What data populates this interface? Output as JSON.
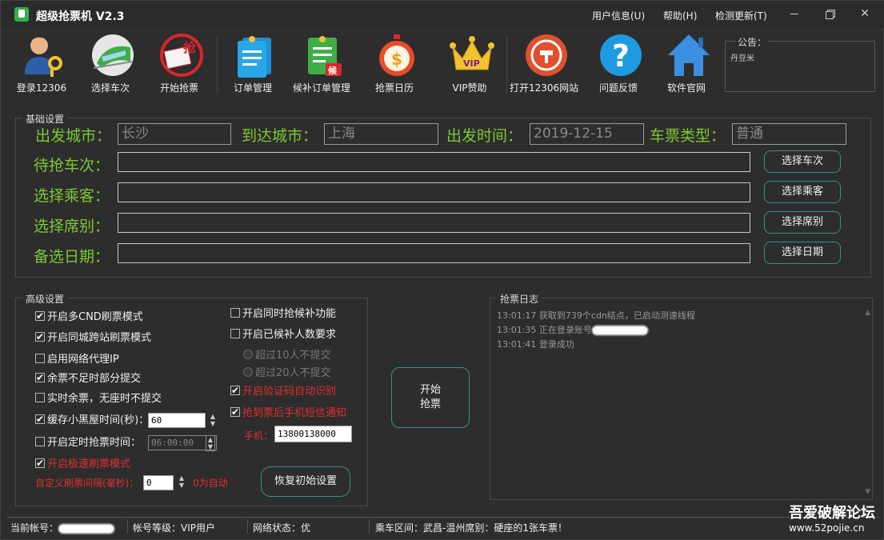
{
  "titlebar": {
    "title": "超级抢票机 V2.3",
    "menu_user": "用户信息(U)",
    "menu_help": "帮助(H)",
    "menu_update": "检测更新(T)"
  },
  "toolbar": {
    "login": "登录12306",
    "select_train": "选择车次",
    "start_grab": "开始抢票",
    "order_mgmt": "订单管理",
    "waitlist_mgmt": "候补订单管理",
    "grab_calendar": "抢票日历",
    "vip": "VIP赞助",
    "open_site": "打开12306网站",
    "feedback": "问题反馈",
    "official_site": "软件官网",
    "vip_badge": "VIP",
    "waitlist_badge": "候",
    "grab_badge": "抢"
  },
  "notice": {
    "title": "公告：",
    "body": "丹豆米"
  },
  "basic": {
    "title": "基础设置",
    "from_label": "出发城市：",
    "from_value": "长沙",
    "to_label": "到达城市：",
    "to_value": "上海",
    "date_label": "出发时间：",
    "date_value": "2019-12-15",
    "type_label": "车票类型：",
    "type_value": "普通",
    "train_label": "待抢车次：",
    "passenger_label": "选择乘客：",
    "seat_label": "选择席别：",
    "altdate_label": "备选日期：",
    "btn_train": "选择车次",
    "btn_passenger": "选择乘客",
    "btn_seat": "选择席别",
    "btn_date": "选择日期"
  },
  "advanced": {
    "title": "高级设置",
    "cnd_refresh": "开启多CND刷票模式",
    "same_city": "开启同城跨站刷票模式",
    "proxy": "启用网络代理IP",
    "partial": "余票不足时部分提交",
    "realtime": "实时余票，无座时不提交",
    "blacklist": "缓存小黑屋时间(秒)：",
    "blacklist_value": "60",
    "timed": "开启定时抢票时间：",
    "timed_value": "06:00:00",
    "fast": "开启极速刷票模式",
    "interval_label": "自定义刷票间隔(毫秒)：",
    "interval_value": "0",
    "interval_hint": "0为自动",
    "waitlist_same": "开启同时抢候补功能",
    "waitlist_count": "开启已候补人数要求",
    "over10": "超过10人不提交",
    "over20": "超过20人不提交",
    "captcha": "开启验证码自动识别",
    "sms": "抢到票后手机短信通知",
    "phone_label": "手机：",
    "phone_value": "13800138000",
    "reset": "恢复初始设置",
    "start_line1": "开始",
    "start_line2": "抢票"
  },
  "log": {
    "title": "抢票日志",
    "line1": "13:01:17 获取到739个cdn结点，已启动测速线程",
    "line2_prefix": "13:01:35 正在登录账号",
    "line3": "13:01:41 登录成功"
  },
  "statusbar": {
    "account": "当前帐号：",
    "level": "帐号等级：VIP用户",
    "network": "网络状态：优",
    "route": "乘车区间：武昌-温州席别：硬座的1张车票！"
  },
  "watermark": {
    "line1": "吾爱破解论坛",
    "line2": "www.52pojie.cn"
  },
  "colors": {
    "accent_green": "#7dc832",
    "alert_red": "#e03030",
    "button_border": "#3a8f8a"
  }
}
